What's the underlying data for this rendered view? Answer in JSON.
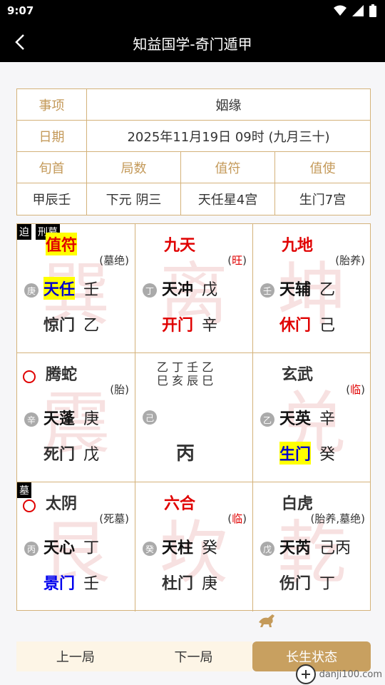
{
  "status_bar": {
    "time": "9:07"
  },
  "app_bar": {
    "title": "知益国学-奇门遁甲"
  },
  "info_table": {
    "row1": {
      "label": "事项",
      "value": "姻缘"
    },
    "row2": {
      "label": "日期",
      "value": "2025年11月19日 09时 (九月三十)"
    },
    "row3": {
      "c1": "旬首",
      "c2": "局数",
      "c3": "值符",
      "c4": "值使"
    },
    "row4": {
      "c1": "甲辰壬",
      "c2": "下元 阴三",
      "c3": "天任星4宫",
      "c4": "生门7宫"
    }
  },
  "palaces": {
    "p0": {
      "bg": "巽",
      "tags": [
        "迫",
        "刑墓"
      ],
      "god": "值符",
      "status": "(墓绝)",
      "stem_circle": "庚",
      "star": "天任",
      "star_stem": "壬",
      "door": "惊门",
      "door_stem": "乙"
    },
    "p1": {
      "bg": "离",
      "god": "九天",
      "status_pre": "(",
      "status_red": "旺",
      "status_post": ")",
      "stem_circle": "丁",
      "star": "天冲",
      "star_stem": "戊",
      "door": "开门",
      "door_stem": "辛"
    },
    "p2": {
      "bg": "坤",
      "god": "九地",
      "status": "(胎养)",
      "stem_circle": "壬",
      "star": "天辅",
      "star_stem": "乙",
      "door": "休门",
      "door_stem": "己"
    },
    "p3": {
      "bg": "震",
      "god": "腾蛇",
      "status": "(胎)",
      "stem_circle": "辛",
      "star": "天蓬",
      "star_stem": "庚",
      "door": "死门",
      "door_stem": "戊"
    },
    "p4": {
      "row1": "乙 丁 壬 乙",
      "row2": "巳 亥 辰 巳",
      "stem_circle": "己",
      "main": "丙"
    },
    "p5": {
      "bg": "兑",
      "god": "玄武",
      "status_pre": "(",
      "status_red": "临",
      "status_post": ")",
      "stem_circle": "乙",
      "star": "天英",
      "star_stem": "辛",
      "door": "生门",
      "door_stem": "癸"
    },
    "p6": {
      "bg": "艮",
      "tags": [
        "墓"
      ],
      "god": "太阴",
      "status": "(死墓)",
      "stem_circle": "丙",
      "star": "天心",
      "star_stem": "丁",
      "door": "景门",
      "door_stem": "壬"
    },
    "p7": {
      "bg": "坎",
      "god": "六合",
      "status_pre": "(",
      "status_red": "临",
      "status_post": ")",
      "stem_circle": "癸",
      "star": "天柱",
      "star_stem": "癸",
      "door": "杜门",
      "door_stem": "庚"
    },
    "p8": {
      "bg": "乾",
      "god": "白虎",
      "status": "(胎养,墓绝)",
      "stem_circle": "戊",
      "star": "天芮",
      "star_stem": "己丙",
      "door": "伤门",
      "door_stem": "丁"
    }
  },
  "bottom": {
    "prev": "上一局",
    "next": "下一局",
    "state": "长生状态"
  },
  "watermark": {
    "text": "danji100.com"
  },
  "colors": {
    "gold": "#c49a5a",
    "red": "#e00000",
    "highlight": "#ffff00",
    "blue": "#0000ee"
  }
}
